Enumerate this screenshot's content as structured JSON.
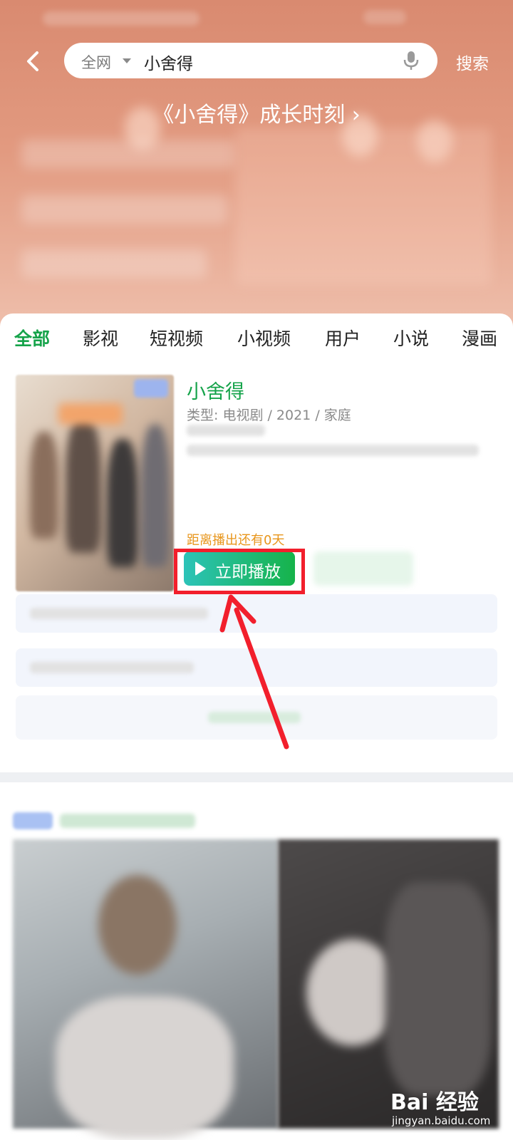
{
  "header": {
    "back_icon": "chevron-left-icon",
    "search_scope": "全网",
    "search_query": "小舍得",
    "mic_icon": "microphone-icon",
    "search_button": "搜索",
    "banner_title": "《小舍得》成长时刻 ›"
  },
  "tabs": [
    {
      "label": "全部",
      "active": true
    },
    {
      "label": "影视",
      "active": false
    },
    {
      "label": "短视频",
      "active": false
    },
    {
      "label": "小视频",
      "active": false
    },
    {
      "label": "用户",
      "active": false
    },
    {
      "label": "小说",
      "active": false
    },
    {
      "label": "漫画",
      "active": false
    }
  ],
  "result": {
    "title": "小舍得",
    "meta": "类型: 电视剧 / 2021 / 家庭",
    "countdown": "距离播出还有0天",
    "play_button": "立即播放",
    "play_icon": "play-icon"
  },
  "colors": {
    "accent_green": "#15a34a",
    "countdown_orange": "#e8961c",
    "highlight_red": "#f21f2c"
  },
  "watermark": {
    "text": "Bai 经验",
    "sub": "jingyan.baidu.com"
  }
}
